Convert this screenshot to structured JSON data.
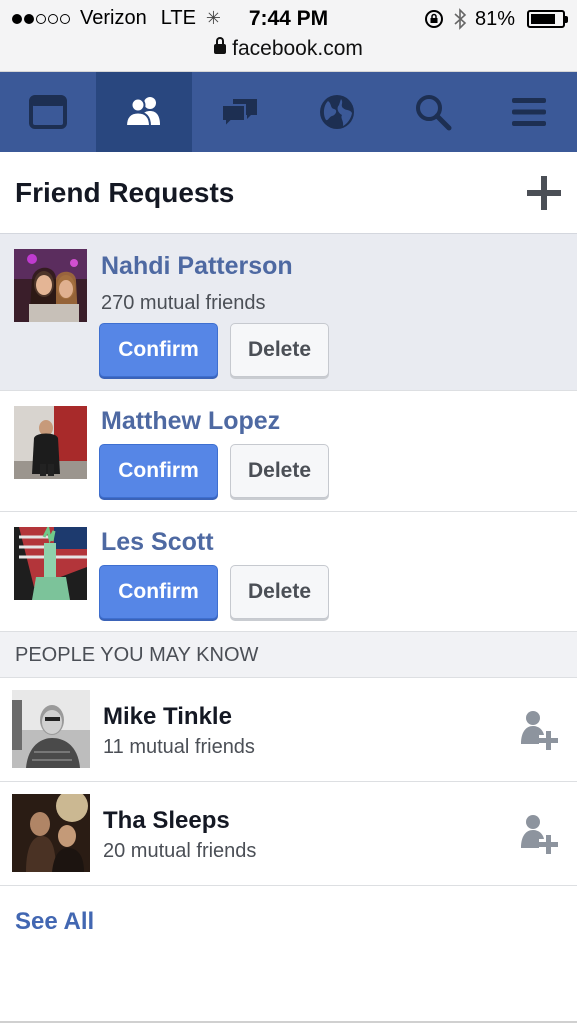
{
  "status_bar": {
    "carrier": "Verizon",
    "network": "LTE",
    "time": "7:44 PM",
    "battery_percent": "81%",
    "battery_level": 0.81,
    "url": "facebook.com",
    "signal_bars": 2
  },
  "nav": {
    "items": [
      {
        "icon": "news-feed-icon"
      },
      {
        "icon": "friends-icon",
        "active": true
      },
      {
        "icon": "messages-icon"
      },
      {
        "icon": "globe-icon"
      },
      {
        "icon": "search-icon"
      },
      {
        "icon": "menu-icon"
      }
    ]
  },
  "header": {
    "title": "Friend Requests"
  },
  "requests": [
    {
      "name": "Nahdi Patterson",
      "mutual": "270 mutual friends",
      "confirm": "Confirm",
      "delete": "Delete"
    },
    {
      "name": "Matthew Lopez",
      "confirm": "Confirm",
      "delete": "Delete"
    },
    {
      "name": "Les Scott",
      "confirm": "Confirm",
      "delete": "Delete"
    }
  ],
  "pymk": {
    "title": "PEOPLE YOU MAY KNOW",
    "people": [
      {
        "name": "Mike Tinkle",
        "mutual": "11 mutual friends"
      },
      {
        "name": "Tha Sleeps",
        "mutual": "20 mutual friends"
      }
    ]
  },
  "see_all": "See All",
  "colors": {
    "nav_blue": "#3b5998",
    "confirm_blue": "#5686e6",
    "name_blue": "#4e69a2"
  }
}
